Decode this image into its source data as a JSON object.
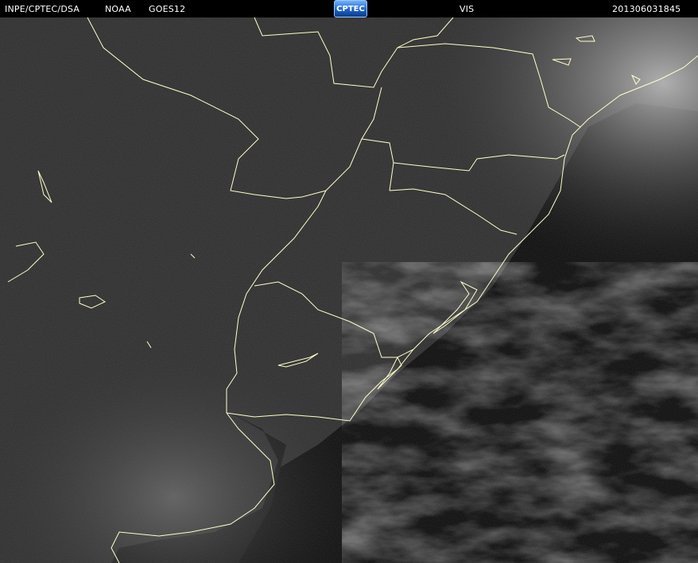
{
  "header": {
    "agency": "INPE/CPTEC/DSA",
    "provider": "NOAA",
    "satellite": "GOES12",
    "logo_text": "CPTEC",
    "channel": "VIS",
    "timestamp": "201306031845"
  },
  "colors": {
    "background": "#000000",
    "text": "#ffffff",
    "borders": "#ffffcc",
    "logo": "#1a5fc4"
  }
}
